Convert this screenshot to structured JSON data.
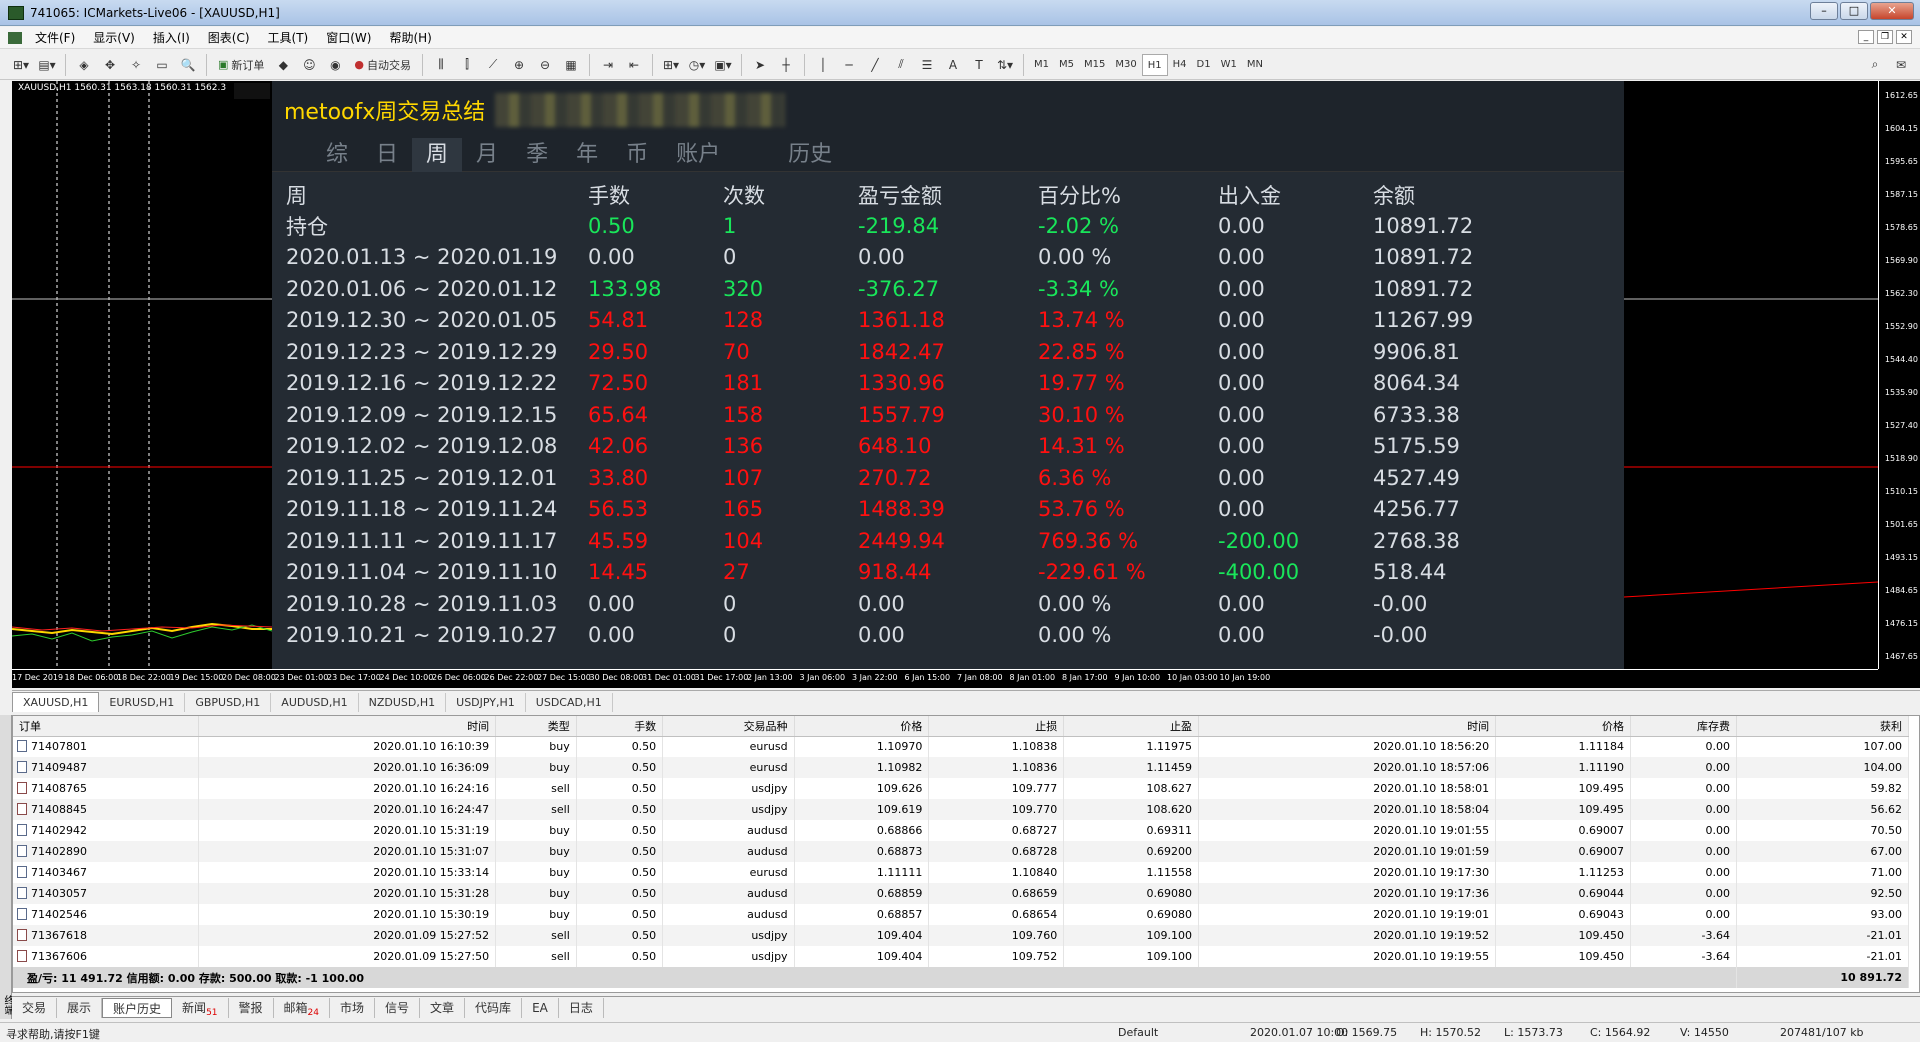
{
  "window": {
    "title": "741065: ICMarkets-Live06 - [XAUUSD,H1]"
  },
  "menu": [
    "文件(F)",
    "显示(V)",
    "插入(I)",
    "图表(C)",
    "工具(T)",
    "窗口(W)",
    "帮助(H)"
  ],
  "toolbar": {
    "new_order": "新订单",
    "auto_trade": "自动交易",
    "timeframes": [
      "M1",
      "M5",
      "M15",
      "M30",
      "H1",
      "H4",
      "D1",
      "W1",
      "MN"
    ],
    "active_timeframe": "H1"
  },
  "chart": {
    "label": "XAUUSD,H1  1560.31 1563.18 1560.31 1562.3",
    "price_ticks": [
      "1612.65",
      "1604.15",
      "1595.65",
      "1587.15",
      "1578.65",
      "1569.90",
      "1562.30",
      "1552.90",
      "1544.40",
      "1535.90",
      "1527.40",
      "1518.90",
      "1510.15",
      "1501.65",
      "1493.15",
      "1484.65",
      "1476.15",
      "1467.65"
    ],
    "time_ticks": [
      "17 Dec 2019",
      "18 Dec 06:00",
      "18 Dec 22:00",
      "19 Dec 15:00",
      "20 Dec 08:00",
      "23 Dec 01:00",
      "23 Dec 17:00",
      "24 Dec 10:00",
      "26 Dec 06:00",
      "26 Dec 22:00",
      "27 Dec 15:00",
      "30 Dec 08:00",
      "31 Dec 01:00",
      "31 Dec 17:00",
      "2 Jan 13:00",
      "3 Jan 06:00",
      "3 Jan 22:00",
      "6 Jan 15:00",
      "7 Jan 08:00",
      "8 Jan 01:00",
      "8 Jan 17:00",
      "9 Jan 10:00",
      "10 Jan 03:00",
      "10 Jan 19:00"
    ]
  },
  "panel": {
    "title": "metoofx周交易总结",
    "tabs": [
      "综",
      "日",
      "周",
      "月",
      "季",
      "年",
      "币",
      "账户",
      "历史"
    ],
    "active_tab": "周",
    "headers": [
      "周",
      "手数",
      "次数",
      "盈亏金额",
      "百分比%",
      "出入金",
      "余额"
    ],
    "rows": [
      {
        "cells": [
          "持仓",
          "0.50",
          "1",
          "-219.84",
          "-2.02 %",
          "0.00",
          "10891.72"
        ],
        "colors": [
          "",
          "g",
          "g",
          "g",
          "g",
          "",
          ""
        ]
      },
      {
        "cells": [
          "2020.01.13 ~ 2020.01.19",
          "0.00",
          "0",
          "0.00",
          "0.00 %",
          "0.00",
          "10891.72"
        ],
        "colors": [
          "",
          "",
          "",
          "",
          "",
          "",
          ""
        ]
      },
      {
        "cells": [
          "2020.01.06 ~ 2020.01.12",
          "133.98",
          "320",
          "-376.27",
          "-3.34 %",
          "0.00",
          "10891.72"
        ],
        "colors": [
          "",
          "g",
          "g",
          "g",
          "g",
          "",
          ""
        ]
      },
      {
        "cells": [
          "2019.12.30 ~ 2020.01.05",
          "54.81",
          "128",
          "1361.18",
          "13.74 %",
          "0.00",
          "11267.99"
        ],
        "colors": [
          "",
          "r",
          "r",
          "r",
          "r",
          "",
          ""
        ]
      },
      {
        "cells": [
          "2019.12.23 ~ 2019.12.29",
          "29.50",
          "70",
          "1842.47",
          "22.85 %",
          "0.00",
          "9906.81"
        ],
        "colors": [
          "",
          "r",
          "r",
          "r",
          "r",
          "",
          ""
        ]
      },
      {
        "cells": [
          "2019.12.16 ~ 2019.12.22",
          "72.50",
          "181",
          "1330.96",
          "19.77 %",
          "0.00",
          "8064.34"
        ],
        "colors": [
          "",
          "r",
          "r",
          "r",
          "r",
          "",
          ""
        ]
      },
      {
        "cells": [
          "2019.12.09 ~ 2019.12.15",
          "65.64",
          "158",
          "1557.79",
          "30.10 %",
          "0.00",
          "6733.38"
        ],
        "colors": [
          "",
          "r",
          "r",
          "r",
          "r",
          "",
          ""
        ]
      },
      {
        "cells": [
          "2019.12.02 ~ 2019.12.08",
          "42.06",
          "136",
          "648.10",
          "14.31 %",
          "0.00",
          "5175.59"
        ],
        "colors": [
          "",
          "r",
          "r",
          "r",
          "r",
          "",
          ""
        ]
      },
      {
        "cells": [
          "2019.11.25 ~ 2019.12.01",
          "33.80",
          "107",
          "270.72",
          "6.36 %",
          "0.00",
          "4527.49"
        ],
        "colors": [
          "",
          "r",
          "r",
          "r",
          "r",
          "",
          ""
        ]
      },
      {
        "cells": [
          "2019.11.18 ~ 2019.11.24",
          "56.53",
          "165",
          "1488.39",
          "53.76 %",
          "0.00",
          "4256.77"
        ],
        "colors": [
          "",
          "r",
          "r",
          "r",
          "r",
          "",
          ""
        ]
      },
      {
        "cells": [
          "2019.11.11 ~ 2019.11.17",
          "45.59",
          "104",
          "2449.94",
          "769.36 %",
          "-200.00",
          "2768.38"
        ],
        "colors": [
          "",
          "r",
          "r",
          "r",
          "r",
          "g",
          ""
        ]
      },
      {
        "cells": [
          "2019.11.04 ~ 2019.11.10",
          "14.45",
          "27",
          "918.44",
          "-229.61 %",
          "-400.00",
          "518.44"
        ],
        "colors": [
          "",
          "r",
          "r",
          "r",
          "r",
          "g",
          ""
        ]
      },
      {
        "cells": [
          "2019.10.28 ~ 2019.11.03",
          "0.00",
          "0",
          "0.00",
          "0.00 %",
          "0.00",
          "-0.00"
        ],
        "colors": [
          "",
          "",
          "",
          "",
          "",
          "",
          ""
        ]
      },
      {
        "cells": [
          "2019.10.21 ~ 2019.10.27",
          "0.00",
          "0",
          "0.00",
          "0.00 %",
          "0.00",
          "-0.00"
        ],
        "colors": [
          "",
          "",
          "",
          "",
          "",
          "",
          ""
        ]
      }
    ]
  },
  "chart_tabs": [
    "XAUUSD,H1",
    "EURUSD,H1",
    "GBPUSD,H1",
    "AUDUSD,H1",
    "NZDUSD,H1",
    "USDJPY,H1",
    "USDCAD,H1"
  ],
  "active_chart_tab": "XAUUSD,H1",
  "terminal": {
    "columns": [
      "订单",
      "时间",
      "类型",
      "手数",
      "交易品种",
      "价格",
      "止损",
      "止盈",
      "时间",
      "价格",
      "库存费",
      "获利"
    ],
    "rows": [
      [
        "71407801",
        "2020.01.10 16:10:39",
        "buy",
        "0.50",
        "eurusd",
        "1.10970",
        "1.10838",
        "1.11975",
        "2020.01.10 18:56:20",
        "1.11184",
        "0.00",
        "107.00"
      ],
      [
        "71409487",
        "2020.01.10 16:36:09",
        "buy",
        "0.50",
        "eurusd",
        "1.10982",
        "1.10836",
        "1.11459",
        "2020.01.10 18:57:06",
        "1.11190",
        "0.00",
        "104.00"
      ],
      [
        "71408765",
        "2020.01.10 16:24:16",
        "sell",
        "0.50",
        "usdjpy",
        "109.626",
        "109.777",
        "108.627",
        "2020.01.10 18:58:01",
        "109.495",
        "0.00",
        "59.82"
      ],
      [
        "71408845",
        "2020.01.10 16:24:47",
        "sell",
        "0.50",
        "usdjpy",
        "109.619",
        "109.770",
        "108.620",
        "2020.01.10 18:58:04",
        "109.495",
        "0.00",
        "56.62"
      ],
      [
        "71402942",
        "2020.01.10 15:31:19",
        "buy",
        "0.50",
        "audusd",
        "0.68866",
        "0.68727",
        "0.69311",
        "2020.01.10 19:01:55",
        "0.69007",
        "0.00",
        "70.50"
      ],
      [
        "71402890",
        "2020.01.10 15:31:07",
        "buy",
        "0.50",
        "audusd",
        "0.68873",
        "0.68728",
        "0.69200",
        "2020.01.10 19:01:59",
        "0.69007",
        "0.00",
        "67.00"
      ],
      [
        "71403467",
        "2020.01.10 15:33:14",
        "buy",
        "0.50",
        "eurusd",
        "1.11111",
        "1.10840",
        "1.11558",
        "2020.01.10 19:17:30",
        "1.11253",
        "0.00",
        "71.00"
      ],
      [
        "71403057",
        "2020.01.10 15:31:28",
        "buy",
        "0.50",
        "audusd",
        "0.68859",
        "0.68659",
        "0.69080",
        "2020.01.10 19:17:36",
        "0.69044",
        "0.00",
        "92.50"
      ],
      [
        "71402546",
        "2020.01.10 15:30:19",
        "buy",
        "0.50",
        "audusd",
        "0.68857",
        "0.68654",
        "0.69080",
        "2020.01.10 19:19:01",
        "0.69043",
        "0.00",
        "93.00"
      ],
      [
        "71367618",
        "2020.01.09 15:27:52",
        "sell",
        "0.50",
        "usdjpy",
        "109.404",
        "109.760",
        "109.100",
        "2020.01.10 19:19:52",
        "109.450",
        "-3.64",
        "-21.01"
      ],
      [
        "71367606",
        "2020.01.09 15:27:50",
        "sell",
        "0.50",
        "usdjpy",
        "109.404",
        "109.752",
        "109.100",
        "2020.01.10 19:19:55",
        "109.450",
        "-3.64",
        "-21.01"
      ]
    ],
    "summary": "盈/亏: 11 491.72  信用额: 0.00  存款: 500.00  取款: -1 100.00",
    "summary_total": "10 891.72",
    "side_label": "终端"
  },
  "terminal_tabs": [
    {
      "label": "交易",
      "badge": ""
    },
    {
      "label": "展示",
      "badge": ""
    },
    {
      "label": "账户历史",
      "badge": ""
    },
    {
      "label": "新闻",
      "badge": "51"
    },
    {
      "label": "警报",
      "badge": ""
    },
    {
      "label": "邮箱",
      "badge": "24"
    },
    {
      "label": "市场",
      "badge": ""
    },
    {
      "label": "信号",
      "badge": ""
    },
    {
      "label": "文章",
      "badge": ""
    },
    {
      "label": "代码库",
      "badge": ""
    },
    {
      "label": "EA",
      "badge": ""
    },
    {
      "label": "日志",
      "badge": ""
    }
  ],
  "active_terminal_tab": "账户历史",
  "status": {
    "help": "寻求帮助,请按F1键",
    "profile": "Default",
    "datetime": "2020.01.07 10:00",
    "open": "O: 1569.75",
    "high": "H: 1570.52",
    "low": "L: 1573.73",
    "close": "C: 1564.92",
    "volume": "V: 14550",
    "traffic": "207481/107 kb"
  }
}
